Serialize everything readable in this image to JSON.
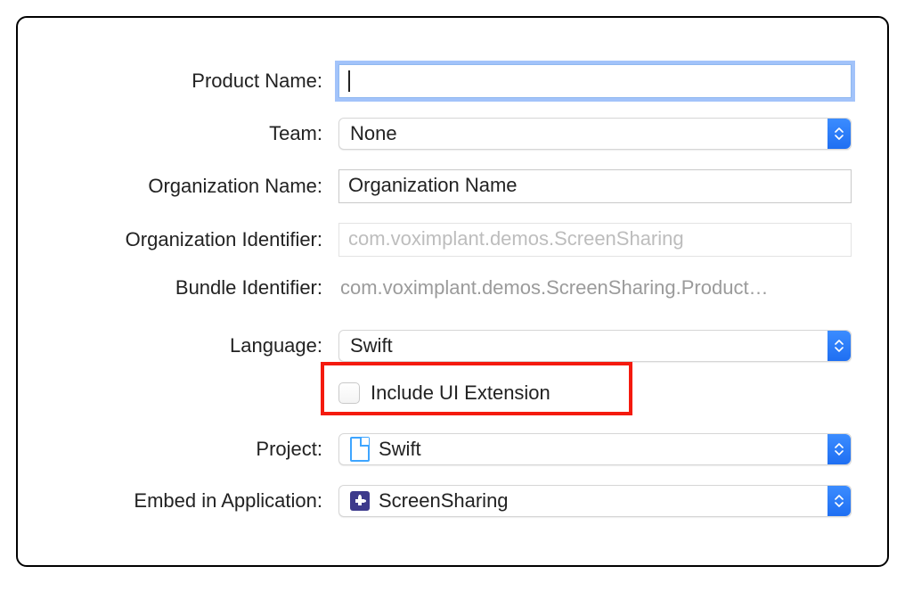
{
  "labels": {
    "product_name": "Product Name:",
    "team": "Team:",
    "organization_name": "Organization Name:",
    "organization_identifier": "Organization Identifier:",
    "bundle_identifier": "Bundle Identifier:",
    "language": "Language:",
    "project": "Project:",
    "embed_in_application": "Embed in Application:"
  },
  "fields": {
    "product_name_value": "",
    "team_value": "None",
    "organization_name_value": "Organization Name",
    "organization_identifier_placeholder": "com.voximplant.demos.ScreenSharing",
    "bundle_identifier_value": "com.voximplant.demos.ScreenSharing.Product…",
    "language_value": "Swift",
    "include_ui_extension_label": "Include UI Extension",
    "include_ui_extension_checked": false,
    "project_value": "Swift",
    "embed_value": "ScreenSharing"
  }
}
